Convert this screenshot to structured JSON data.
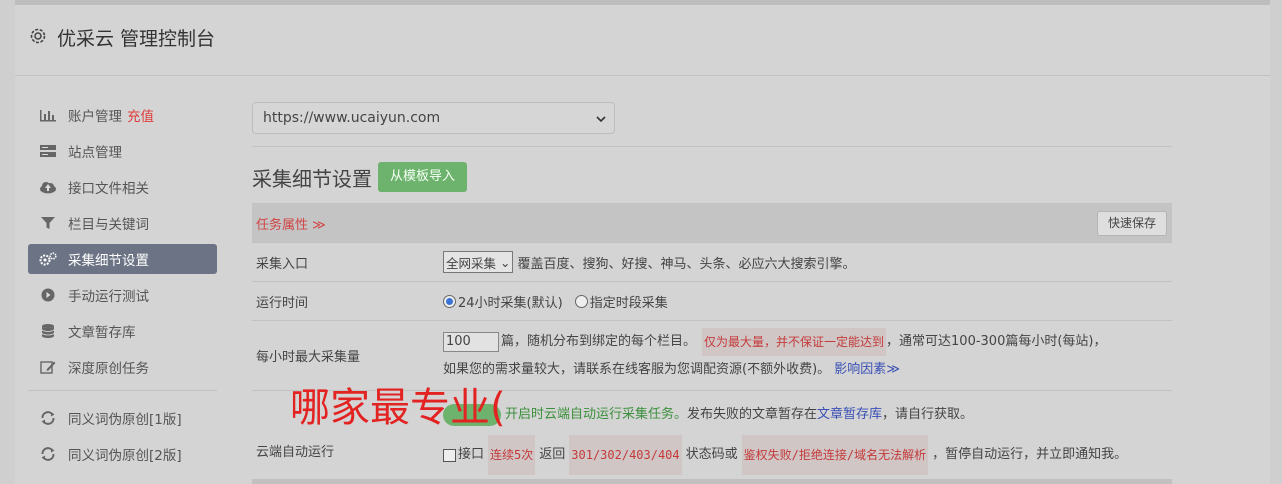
{
  "header": {
    "title": "优采云 管理控制台"
  },
  "sidebar": {
    "items": [
      {
        "icon": "bar-chart-icon",
        "label": "账户管理",
        "extra": "充值"
      },
      {
        "icon": "server-icon",
        "label": "站点管理"
      },
      {
        "icon": "cloud-upload-icon",
        "label": "接口文件相关"
      },
      {
        "icon": "filter-icon",
        "label": "栏目与关键词"
      },
      {
        "icon": "cogs-icon",
        "label": "采集细节设置",
        "active": true
      },
      {
        "icon": "play-circle-icon",
        "label": "手动运行测试"
      },
      {
        "icon": "database-icon",
        "label": "文章暂存库"
      },
      {
        "icon": "edit-icon",
        "label": "深度原创任务"
      }
    ],
    "items2": [
      {
        "icon": "refresh-icon",
        "label": "同义词伪原创[1版]"
      },
      {
        "icon": "refresh-icon",
        "label": "同义词伪原创[2版]"
      }
    ]
  },
  "main": {
    "site_select": "https://www.ucaiyun.com",
    "section_title": "采集细节设置",
    "import_button": "从模板导入",
    "task_attr": "任务属性",
    "quick_save": "快速保存",
    "rows": {
      "entry": {
        "label": "采集入口",
        "select": "全网采集",
        "desc": "覆盖百度、搜狗、好搜、神马、头条、必应六大搜索引擎。"
      },
      "runtime": {
        "label": "运行时间",
        "opt1": "24小时采集(默认)",
        "opt2": "指定时段采集"
      },
      "max": {
        "label": "每小时最大采集量",
        "value": "100",
        "t1": "篇，随机分布到绑定的每个栏目。",
        "tag": "仅为最大量，并不保证一定能达到",
        "t2": "，通常可达100-300篇每小时(每站)，",
        "t3": "如果您的需求量较大，请联系在线客服为您调配资源(不额外收费)。",
        "link": "影响因素"
      },
      "cloud": {
        "label": "云端自动运行",
        "green": "开启时云端自动运行采集任务。",
        "t1": "发布失败的文章暂存在",
        "link": "文章暂存库",
        "t2": "，请自行获取。",
        "c1": "接口",
        "tag1": "连续5次",
        "c2": "返回",
        "tag2": "301/302/403/404",
        "c3": "状态码或",
        "tag3": "鉴权失败/拒绝连接/域名无法解析",
        "c4": "，暂停自动运行，并立即通知我。"
      }
    }
  },
  "overlay_text": "哪家最专业(",
  "colors": {
    "active_bg": "#6b7384",
    "accent_green": "#6db36d",
    "red": "#e03b3b"
  }
}
